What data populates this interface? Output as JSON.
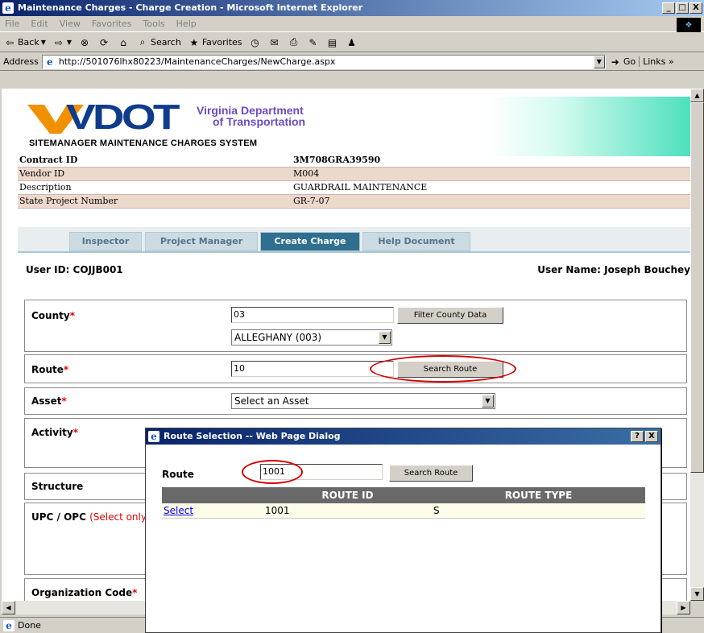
{
  "window": {
    "title": "Maintenance Charges - Charge Creation - Microsoft Internet Explorer",
    "buttons": [
      "_",
      "□",
      "X"
    ]
  },
  "menubar": [
    "File",
    "Edit",
    "View",
    "Favorites",
    "Tools",
    "Help"
  ],
  "toolbar": {
    "back": "Back",
    "search": "Search",
    "favorites": "Favorites"
  },
  "address": {
    "label": "Address",
    "url": "http://501076lhx80223/MaintenanceCharges/NewCharge.aspx",
    "go": "Go",
    "links": "Links"
  },
  "banner": {
    "logo": "VDOT",
    "dept_line1": "Virginia Department",
    "dept_line2": "of Transportation",
    "system": "SITEMANAGER MAINTENANCE CHARGES SYSTEM"
  },
  "info": [
    {
      "label": "Contract ID",
      "value": "3M708GRA39590"
    },
    {
      "label": "Vendor ID",
      "value": "M004"
    },
    {
      "label": "Description",
      "value": "GUARDRAIL MAINTENANCE"
    },
    {
      "label": "State Project Number",
      "value": "GR-7-07"
    }
  ],
  "tabs": [
    "Inspector",
    "Project Manager",
    "Create Charge",
    "Help Document"
  ],
  "active_tab": "Create Charge",
  "user": {
    "id": "User ID: COJJB001",
    "name": "User Name: Joseph Bouchey"
  },
  "form": {
    "county": {
      "label": "County",
      "value": "03",
      "filter_button": "Filter County Data",
      "select_value": "ALLEGHANY (003)"
    },
    "route": {
      "label": "Route",
      "value": "10",
      "search_button": "Search Route"
    },
    "asset": {
      "label": "Asset",
      "select_value": "Select an Asset"
    },
    "activity": {
      "label": "Activity"
    },
    "structure": {
      "label": "Structure"
    },
    "upc": {
      "label": "UPC / OPC",
      "note": "(Select only"
    },
    "org": {
      "label": "Organization Code"
    },
    "required_mark": "*"
  },
  "dialog": {
    "title": "Route Selection -- Web Page Dialog",
    "buttons": [
      "?",
      "X"
    ],
    "route_label": "Route",
    "route_value": "1001",
    "search_button": "Search Route",
    "columns": [
      "",
      "ROUTE ID",
      "ROUTE TYPE"
    ],
    "rows": [
      {
        "action": "Select",
        "route_id": "1001",
        "route_type": "S"
      }
    ]
  },
  "status": {
    "text": "Done"
  }
}
